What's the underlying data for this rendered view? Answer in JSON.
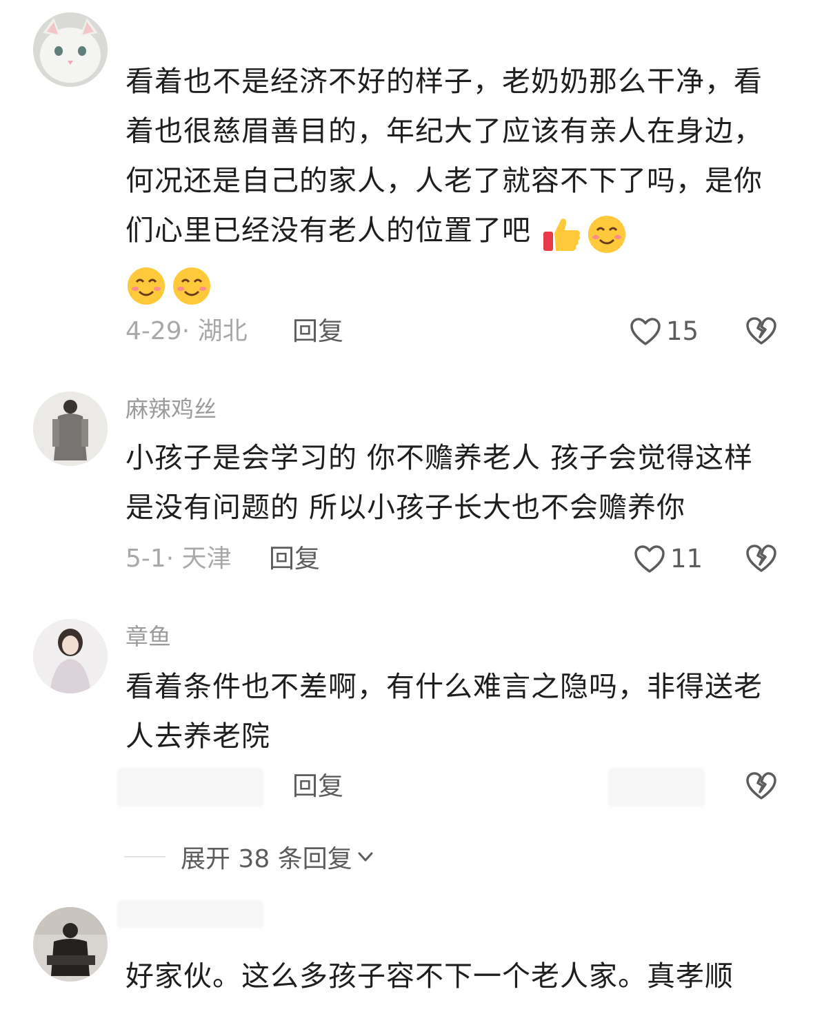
{
  "comments": [
    {
      "text": "看着也不是经济不好的样子，老奶奶那么干净，看着也很慈眉善目的，年纪大了应该有亲人在身边，何况还是自己的家人，人老了就容不下了吗，是你们心里已经没有老人的位置了吧",
      "emojis": [
        "thumbs-up",
        "smile",
        "smile",
        "smile"
      ],
      "meta": "4-29· 湖北",
      "reply_label": "回复",
      "likes": "15"
    },
    {
      "username": "麻辣鸡丝",
      "text": "小孩子是会学习的 你不赡养老人 孩子会觉得这样是没有问题的 所以小孩子长大也不会赡养你",
      "meta": "5-1· 天津",
      "reply_label": "回复",
      "likes": "11"
    },
    {
      "username": "章鱼",
      "text": "看着条件也不差啊，有什么难言之隐吗，非得送老人去养老院",
      "reply_label": "回复"
    },
    {
      "text": "好家伙。这么多孩子容不下一个老人家。真孝顺"
    }
  ],
  "expand": {
    "label": "展开 38 条回复"
  },
  "colors": {
    "text": "#1e1e1e",
    "meta": "#a8a8a8",
    "action": "#5c5c5c",
    "emoji_yellow": "#ffc93c"
  }
}
